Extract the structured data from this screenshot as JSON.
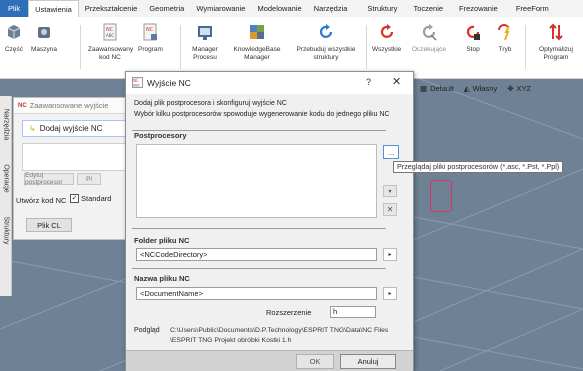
{
  "menu": {
    "items": [
      "Plik",
      "Ustawienia",
      "Przekształcenie",
      "Geometria",
      "Wymiarowanie",
      "Modelowanie",
      "Narzędzia",
      "Struktury",
      "Toczenie",
      "Frezowanie",
      "FreeForm"
    ]
  },
  "ribbon": {
    "buttons": [
      {
        "label": "Część",
        "icon": "part-icon"
      },
      {
        "label": "Maszyna",
        "icon": "machine-icon"
      },
      {
        "label": "Zaawansowany kod NC",
        "icon": "nc-code-icon"
      },
      {
        "label": "Program",
        "icon": "program-icon"
      },
      {
        "label": "Manager Procesu",
        "icon": "process-manager-icon"
      },
      {
        "label": "KnowledgeBase Manager",
        "icon": "knowledgebase-icon"
      },
      {
        "label": "Przebuduj wszystkie struktury",
        "icon": "rebuild-icon"
      },
      {
        "label": "Wszystkie",
        "icon": "refresh-all-icon"
      },
      {
        "label": "Oczekujące",
        "icon": "pending-icon"
      },
      {
        "label": "Stop",
        "icon": "stop-icon"
      },
      {
        "label": "Tryb",
        "icon": "mode-icon"
      },
      {
        "label": "Optymalizuj Program",
        "icon": "optimize-icon"
      }
    ]
  },
  "view_bar": {
    "items": [
      "Default",
      "Własny",
      "XYZ"
    ]
  },
  "vertical_tabs": [
    "Narzędzia",
    "Operacje",
    "Struktury"
  ],
  "background_panel": {
    "title": "Zaawansowane wyjście",
    "add_button": "Dodaj wyjście NC",
    "edit_button": "Edytuj postprocesor",
    "pl_button": "Pl",
    "create_nc_label": "Utwórz kod NC",
    "standard_checkbox": "Standard",
    "plik_cl_button": "Plik CL"
  },
  "dialog": {
    "title": "Wyjście NC",
    "help": "?",
    "close": "✕",
    "description_1": "Dodaj plik postprocesora i skonfiguruj wyjście NC",
    "description_2": "Wybór kilku postprocesorów spowoduje wygenerowanie kodu do jednego pliku NC",
    "postprocessors_label": "Postprocesory",
    "browse_button": "...",
    "down_button": "▾",
    "remove_button": "✕",
    "folder_label": "Folder pliku NC",
    "folder_value": "<NCCodeDirectory>",
    "filename_label": "Nazwa pliku NC",
    "filename_value": "<DocumentName>",
    "extension_label": "Rozszerzenie",
    "extension_value": "h",
    "preview_label": "Podgląd",
    "preview_line_1": "C:\\Users\\Public\\Documents\\D.P.Technology\\ESPRIT TNG\\Data\\NC Files",
    "preview_line_2": "\\ESPRIT TNG Projekt obróbki Kostki 1.h",
    "ok_button": "OK",
    "cancel_button": "Anuluj"
  },
  "tooltip": {
    "text": "Przeglądaj pliki postprocesorów (*.asc, *.Pst, *.Ppl)"
  },
  "colors": {
    "file_menu": "#2f6fb8",
    "workspace": "#6f8194",
    "refresh_blue": "#2a7ad3",
    "stop_red": "#d9302c"
  }
}
